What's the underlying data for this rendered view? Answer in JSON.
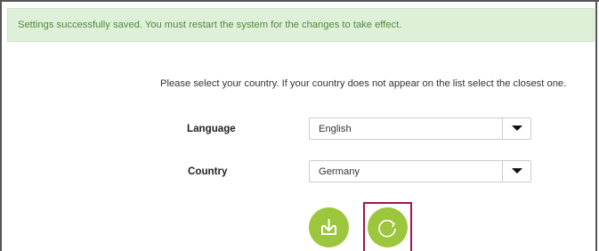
{
  "alert": {
    "message": "Settings successfully saved. You must restart the system for the changes to take effect."
  },
  "instruction": "Please select your country. If your country does not appear on the list select the closest one.",
  "form": {
    "language": {
      "label": "Language",
      "value": "English"
    },
    "country": {
      "label": "Country",
      "value": "Germany"
    }
  },
  "actions": {
    "save_icon": "download-tray-icon",
    "restart_icon": "refresh-icon"
  },
  "colors": {
    "alert_bg": "#dff0d8",
    "alert_text": "#4f8a3c",
    "button_green": "#9cc63c",
    "highlight": "#a0174a"
  }
}
